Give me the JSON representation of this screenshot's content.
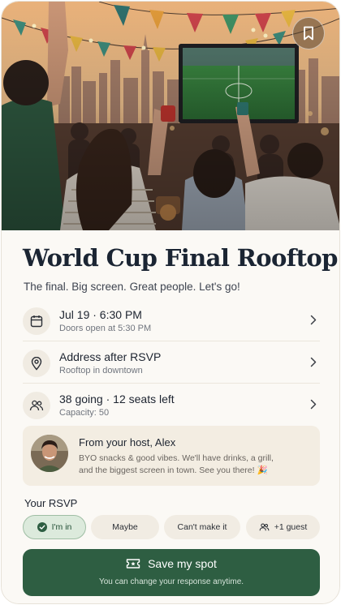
{
  "hero": {
    "image_description": "",
    "bookmark_icon": "bookmark-icon"
  },
  "event": {
    "title": "World Cup Final Rooftop",
    "tagline": "The final. Big screen. Great people. Let's go!"
  },
  "details": [
    {
      "icon": "calendar-icon",
      "main": "Jul 19 · 6:30 PM",
      "sub": "Doors open at 5:30 PM"
    },
    {
      "icon": "location-pin-icon",
      "main": "Address after RSVP",
      "sub": "Rooftop in downtown"
    },
    {
      "icon": "people-icon",
      "main": "38 going · 12 seats left",
      "sub": "Capacity: 50"
    }
  ],
  "host": {
    "title": "From your host, Alex",
    "message": "BYO snacks & good vibes. We'll have drinks, a grill, and the biggest screen in town. See you there! 🎉"
  },
  "rsvp": {
    "label": "Your RSVP",
    "options": [
      {
        "label": "I'm in",
        "selected": true,
        "icon": "check-circle-icon"
      },
      {
        "label": "Maybe",
        "selected": false
      },
      {
        "label": "Can't make it",
        "selected": false
      },
      {
        "label": "+1 guest",
        "selected": false,
        "icon": "people-icon"
      }
    ]
  },
  "cta": {
    "label": "Save my spot",
    "icon": "ticket-icon",
    "note": "You can change your response anytime."
  },
  "colors": {
    "accent_green": "#2e5e42",
    "selected_pill_bg": "#dceadc",
    "card_bg": "#f3ede2",
    "title_color": "#1b2533"
  }
}
